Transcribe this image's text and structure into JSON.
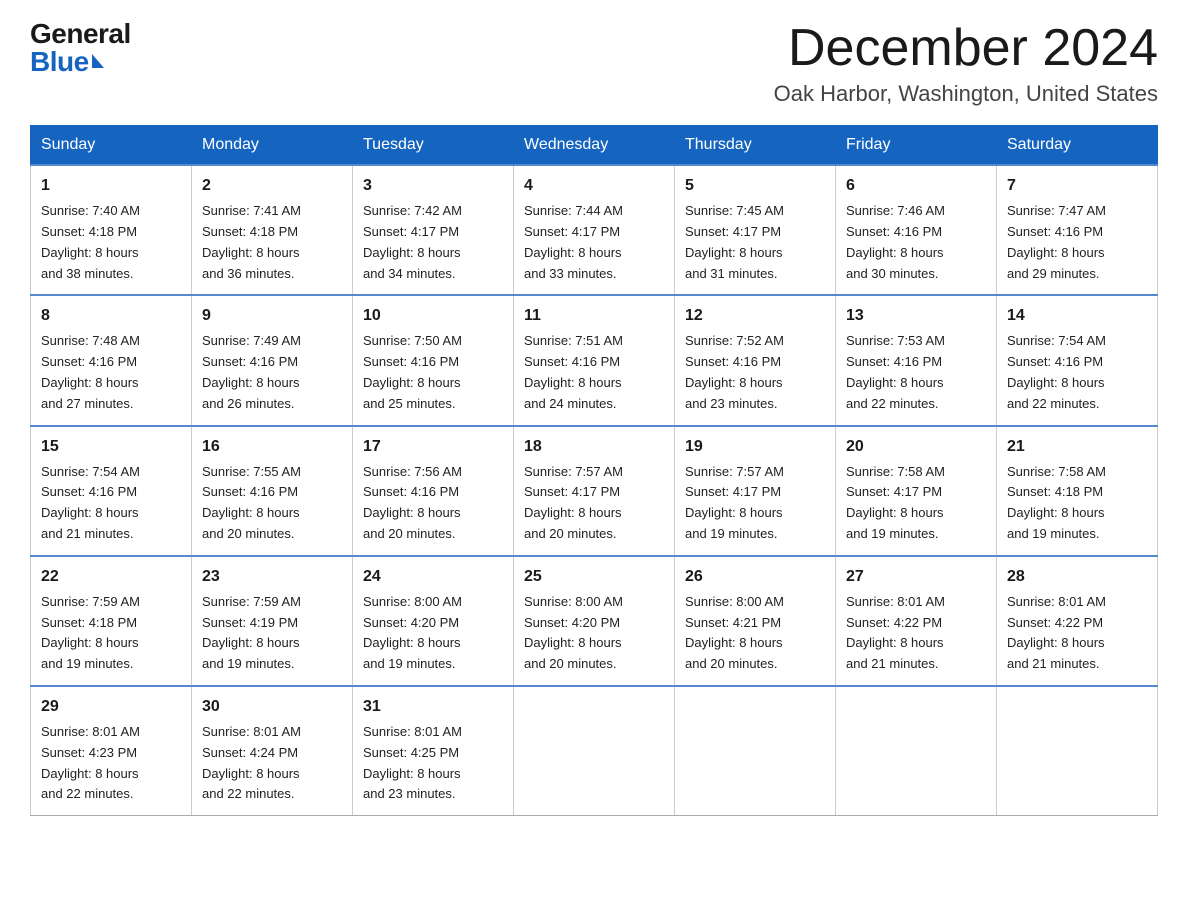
{
  "header": {
    "logo_general": "General",
    "logo_blue": "Blue",
    "month_title": "December 2024",
    "location": "Oak Harbor, Washington, United States"
  },
  "days_of_week": [
    "Sunday",
    "Monday",
    "Tuesday",
    "Wednesday",
    "Thursday",
    "Friday",
    "Saturday"
  ],
  "weeks": [
    [
      {
        "day": "1",
        "sunrise": "7:40 AM",
        "sunset": "4:18 PM",
        "daylight": "8 hours and 38 minutes."
      },
      {
        "day": "2",
        "sunrise": "7:41 AM",
        "sunset": "4:18 PM",
        "daylight": "8 hours and 36 minutes."
      },
      {
        "day": "3",
        "sunrise": "7:42 AM",
        "sunset": "4:17 PM",
        "daylight": "8 hours and 34 minutes."
      },
      {
        "day": "4",
        "sunrise": "7:44 AM",
        "sunset": "4:17 PM",
        "daylight": "8 hours and 33 minutes."
      },
      {
        "day": "5",
        "sunrise": "7:45 AM",
        "sunset": "4:17 PM",
        "daylight": "8 hours and 31 minutes."
      },
      {
        "day": "6",
        "sunrise": "7:46 AM",
        "sunset": "4:16 PM",
        "daylight": "8 hours and 30 minutes."
      },
      {
        "day": "7",
        "sunrise": "7:47 AM",
        "sunset": "4:16 PM",
        "daylight": "8 hours and 29 minutes."
      }
    ],
    [
      {
        "day": "8",
        "sunrise": "7:48 AM",
        "sunset": "4:16 PM",
        "daylight": "8 hours and 27 minutes."
      },
      {
        "day": "9",
        "sunrise": "7:49 AM",
        "sunset": "4:16 PM",
        "daylight": "8 hours and 26 minutes."
      },
      {
        "day": "10",
        "sunrise": "7:50 AM",
        "sunset": "4:16 PM",
        "daylight": "8 hours and 25 minutes."
      },
      {
        "day": "11",
        "sunrise": "7:51 AM",
        "sunset": "4:16 PM",
        "daylight": "8 hours and 24 minutes."
      },
      {
        "day": "12",
        "sunrise": "7:52 AM",
        "sunset": "4:16 PM",
        "daylight": "8 hours and 23 minutes."
      },
      {
        "day": "13",
        "sunrise": "7:53 AM",
        "sunset": "4:16 PM",
        "daylight": "8 hours and 22 minutes."
      },
      {
        "day": "14",
        "sunrise": "7:54 AM",
        "sunset": "4:16 PM",
        "daylight": "8 hours and 22 minutes."
      }
    ],
    [
      {
        "day": "15",
        "sunrise": "7:54 AM",
        "sunset": "4:16 PM",
        "daylight": "8 hours and 21 minutes."
      },
      {
        "day": "16",
        "sunrise": "7:55 AM",
        "sunset": "4:16 PM",
        "daylight": "8 hours and 20 minutes."
      },
      {
        "day": "17",
        "sunrise": "7:56 AM",
        "sunset": "4:16 PM",
        "daylight": "8 hours and 20 minutes."
      },
      {
        "day": "18",
        "sunrise": "7:57 AM",
        "sunset": "4:17 PM",
        "daylight": "8 hours and 20 minutes."
      },
      {
        "day": "19",
        "sunrise": "7:57 AM",
        "sunset": "4:17 PM",
        "daylight": "8 hours and 19 minutes."
      },
      {
        "day": "20",
        "sunrise": "7:58 AM",
        "sunset": "4:17 PM",
        "daylight": "8 hours and 19 minutes."
      },
      {
        "day": "21",
        "sunrise": "7:58 AM",
        "sunset": "4:18 PM",
        "daylight": "8 hours and 19 minutes."
      }
    ],
    [
      {
        "day": "22",
        "sunrise": "7:59 AM",
        "sunset": "4:18 PM",
        "daylight": "8 hours and 19 minutes."
      },
      {
        "day": "23",
        "sunrise": "7:59 AM",
        "sunset": "4:19 PM",
        "daylight": "8 hours and 19 minutes."
      },
      {
        "day": "24",
        "sunrise": "8:00 AM",
        "sunset": "4:20 PM",
        "daylight": "8 hours and 19 minutes."
      },
      {
        "day": "25",
        "sunrise": "8:00 AM",
        "sunset": "4:20 PM",
        "daylight": "8 hours and 20 minutes."
      },
      {
        "day": "26",
        "sunrise": "8:00 AM",
        "sunset": "4:21 PM",
        "daylight": "8 hours and 20 minutes."
      },
      {
        "day": "27",
        "sunrise": "8:01 AM",
        "sunset": "4:22 PM",
        "daylight": "8 hours and 21 minutes."
      },
      {
        "day": "28",
        "sunrise": "8:01 AM",
        "sunset": "4:22 PM",
        "daylight": "8 hours and 21 minutes."
      }
    ],
    [
      {
        "day": "29",
        "sunrise": "8:01 AM",
        "sunset": "4:23 PM",
        "daylight": "8 hours and 22 minutes."
      },
      {
        "day": "30",
        "sunrise": "8:01 AM",
        "sunset": "4:24 PM",
        "daylight": "8 hours and 22 minutes."
      },
      {
        "day": "31",
        "sunrise": "8:01 AM",
        "sunset": "4:25 PM",
        "daylight": "8 hours and 23 minutes."
      },
      null,
      null,
      null,
      null
    ]
  ],
  "labels": {
    "sunrise": "Sunrise:",
    "sunset": "Sunset:",
    "daylight": "Daylight:"
  }
}
